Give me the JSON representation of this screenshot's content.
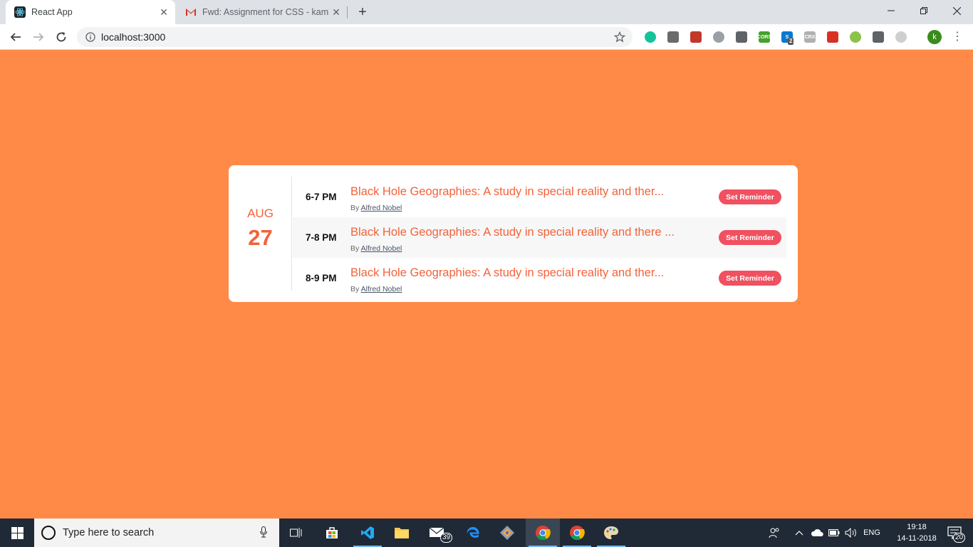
{
  "browser": {
    "tabs": [
      {
        "title": "React App",
        "active": true
      },
      {
        "title": "Fwd: Assignment for CSS - kamin",
        "active": false
      }
    ],
    "new_tab": "+",
    "close_glyph": "✕",
    "url": "localhost:3000",
    "profile_initial": "k",
    "extensions": [
      {
        "name": "grammarly-icon",
        "label": "",
        "color": "#15c39a"
      },
      {
        "name": "angular-icon",
        "label": "",
        "color": "#6b6b6b"
      },
      {
        "name": "pocket-icon",
        "label": "",
        "color": "#c0392b"
      },
      {
        "name": "dots-circle-icon",
        "label": "",
        "color": "#9aa0a6"
      },
      {
        "name": "eyedropper-icon",
        "label": "",
        "color": "#5f6368"
      },
      {
        "name": "cors-icon",
        "label": "CORS",
        "color": "#44a12b"
      },
      {
        "name": "skype-icon",
        "label": "S",
        "color": "#0a79cf",
        "badge": "2"
      },
      {
        "name": "crx-icon",
        "label": "CRX",
        "color": "#b0b0b0"
      },
      {
        "name": "puzzle-red-icon",
        "label": "",
        "color": "#d93025"
      },
      {
        "name": "coin-icon",
        "label": "",
        "color": "#8bc34a"
      },
      {
        "name": "mail-icon",
        "label": "",
        "color": "#5f6368"
      },
      {
        "name": "loader-icon",
        "label": "",
        "color": "#cfcfcf"
      }
    ]
  },
  "schedule": {
    "month": "AUG",
    "day": "27",
    "events": [
      {
        "time": "6-7 PM",
        "title": "Black Hole Geographies: A study in special reality and ther...",
        "by": "By",
        "author": "Alfred Nobel",
        "button": "Set Reminder"
      },
      {
        "time": "7-8 PM",
        "title": "Black Hole Geographies: A study in special reality and there ...",
        "by": "By",
        "author": "Alfred Nobel",
        "button": "Set Reminder"
      },
      {
        "time": "8-9 PM",
        "title": "Black Hole Geographies: A study in special reality and ther...",
        "by": "By",
        "author": "Alfred Nobel",
        "button": "Set Reminder"
      }
    ]
  },
  "taskbar": {
    "search_placeholder": "Type here to search",
    "mail_badge": "39",
    "language": "ENG",
    "time": "19:18",
    "date": "14-11-2018",
    "notification_count": "20"
  }
}
